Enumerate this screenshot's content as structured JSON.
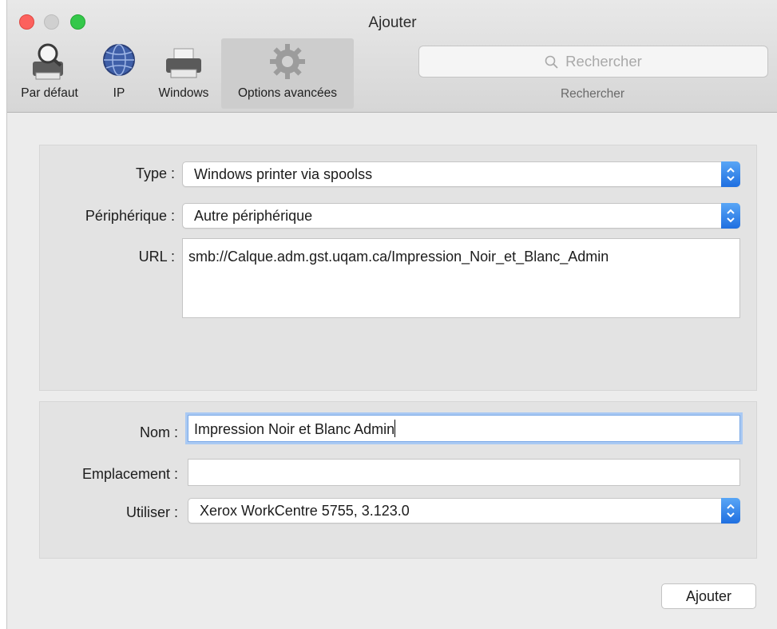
{
  "window": {
    "title": "Ajouter"
  },
  "toolbar": {
    "tools": [
      {
        "label": "Par défaut"
      },
      {
        "label": "IP"
      },
      {
        "label": "Windows"
      },
      {
        "label": "Options avancées"
      }
    ],
    "search": {
      "placeholder": "Rechercher",
      "caption": "Rechercher"
    }
  },
  "device": {
    "type_label": "Type :",
    "type_value": "Windows printer via spoolss",
    "peripheral_label": "Périphérique :",
    "peripheral_value": "Autre périphérique",
    "url_label": "URL :",
    "url_value": "smb://Calque.adm.gst.uqam.ca/Impression_Noir_et_Blanc_Admin"
  },
  "printer": {
    "name_label": "Nom :",
    "name_value": "Impression Noir et Blanc Admin",
    "location_label": "Emplacement :",
    "location_value": "",
    "use_label": "Utiliser :",
    "use_value": "Xerox WorkCentre 5755, 3.123.0"
  },
  "actions": {
    "add_label": "Ajouter"
  },
  "colors": {
    "accent": "#2a7be8",
    "close": "#fc615d",
    "maximize": "#34c84a"
  }
}
